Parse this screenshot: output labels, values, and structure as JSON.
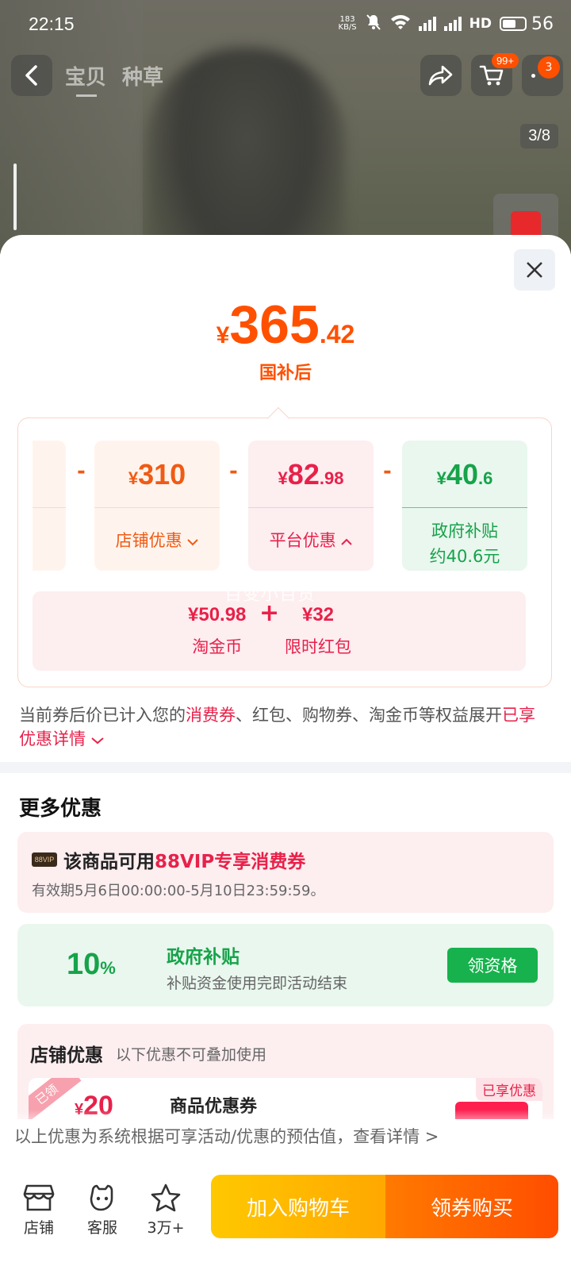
{
  "status_bar": {
    "time": "22:15",
    "net_speed": "183\nKB/S",
    "signal1_label": "5G",
    "signal2_label": "5G",
    "hd_label": "HD",
    "battery": "56"
  },
  "nav": {
    "tabs": [
      {
        "label": "宝贝",
        "active": true
      },
      {
        "label": "种草",
        "active": false
      }
    ],
    "cart_badge": "99+",
    "message_badge": "3"
  },
  "gallery": {
    "page_indicator": "3/8"
  },
  "sheet": {
    "price": {
      "currency": "¥",
      "integer": "365",
      "decimal": ".42",
      "label": "国补后"
    },
    "breakdown": {
      "minus": "-",
      "shop": {
        "currency": "¥",
        "amount": "310",
        "decimal": "",
        "label": "店铺优惠",
        "chevron": "down"
      },
      "platform": {
        "currency": "¥",
        "amount": "82",
        "decimal": ".98",
        "label": "平台优惠",
        "chevron": "up"
      },
      "government": {
        "currency": "¥",
        "amount": "40",
        "decimal": ".6",
        "label_line1": "政府补贴",
        "label_line2": "约40.6元"
      },
      "platform_sub": {
        "watermark": "百变小百货",
        "plus": "+",
        "items": [
          {
            "amount": "¥50.98",
            "label": "淘金币"
          },
          {
            "amount": "¥32",
            "label": "限时红包"
          }
        ]
      }
    },
    "note": {
      "prefix": "当前券后价已计入您的",
      "highlight1": "消费券",
      "middle": "、红包、购物券、淘金币等权益展开",
      "highlight2": "已享优惠详情",
      "chevron": "down"
    },
    "more": {
      "title": "更多优惠",
      "vip": {
        "tag": "88VIP",
        "title_prefix": "该商品可用",
        "title_highlight": "88VIP专享消费券",
        "validity": "有效期5月6日00:00:00-5月10日23:59:59。"
      },
      "gov": {
        "percent_number": "10",
        "percent_sign": "%",
        "title": "政府补贴",
        "subtitle": "补贴资金使用完即活动结束",
        "button": "领资格"
      },
      "shop": {
        "title": "店铺优惠",
        "hint": "以下优惠不可叠加使用",
        "coupon": {
          "ribbon": "已领",
          "currency": "¥",
          "amount": "20",
          "name": "商品优惠券",
          "enjoyed": "已享优惠"
        }
      }
    },
    "estimate_note": "以上优惠为系统根据可享活动/优惠的预估值，查看详情 >"
  },
  "bottom_bar": {
    "shop": "店铺",
    "service": "客服",
    "favorites": "3万+",
    "add_cart": "加入购物车",
    "buy": "领券购买"
  },
  "colors": {
    "price_orange": "#ff5000",
    "shop_orange": "#f05a14",
    "platform_red": "#e8214a",
    "gov_green": "#16a34a",
    "cart_yellow": "#ffb800",
    "buy_orange": "#ff5a00"
  }
}
